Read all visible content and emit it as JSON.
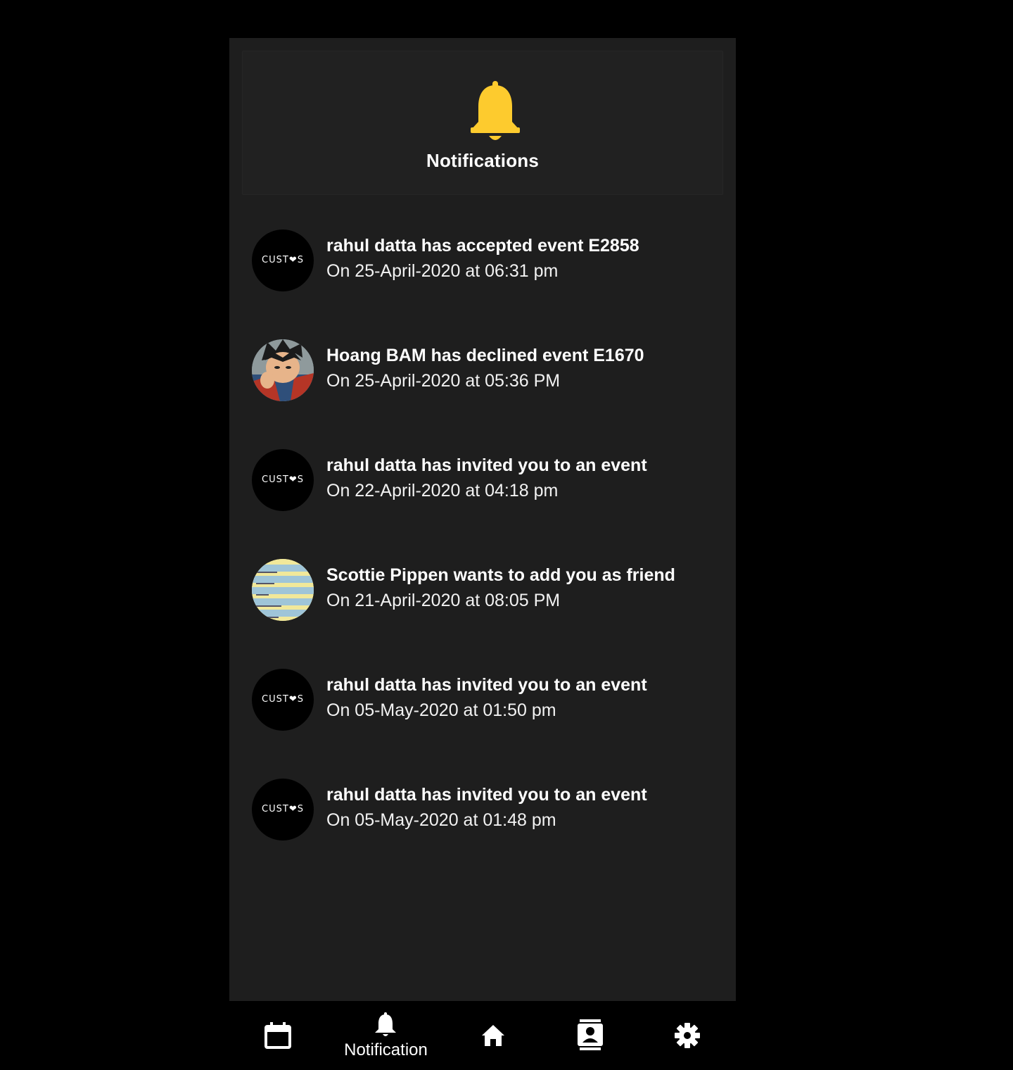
{
  "header": {
    "title": "Notifications",
    "icon": "bell-icon",
    "icon_color": "#FDCB2E"
  },
  "notifications": [
    {
      "avatar": "custos-logo",
      "title": "rahul datta has accepted event E2858",
      "date": "On 25-April-2020 at 06:31 pm"
    },
    {
      "avatar": "user-photo",
      "title": "Hoang BAM has declined event E1670",
      "date": "On 25-April-2020 at 05:36 PM"
    },
    {
      "avatar": "custos-logo",
      "title": "rahul datta has invited you to an event",
      "date": "On 22-April-2020 at 04:18 pm"
    },
    {
      "avatar": "user-photo",
      "title": "Scottie Pippen wants to add you as friend",
      "date": "On 21-April-2020 at 08:05 PM"
    },
    {
      "avatar": "custos-logo",
      "title": "rahul datta has invited you to an event",
      "date": "On 05-May-2020 at 01:50 pm"
    },
    {
      "avatar": "custos-logo",
      "title": "rahul datta has invited you to an event",
      "date": "On 05-May-2020 at 01:48 pm"
    }
  ],
  "avatar_logo_text": "CUST❤S",
  "bottom_nav": {
    "items": [
      {
        "icon": "calendar-icon"
      },
      {
        "icon": "bell-icon",
        "label": "Notification",
        "active": true
      },
      {
        "icon": "home-icon"
      },
      {
        "icon": "contacts-icon"
      },
      {
        "icon": "gear-icon"
      }
    ]
  }
}
